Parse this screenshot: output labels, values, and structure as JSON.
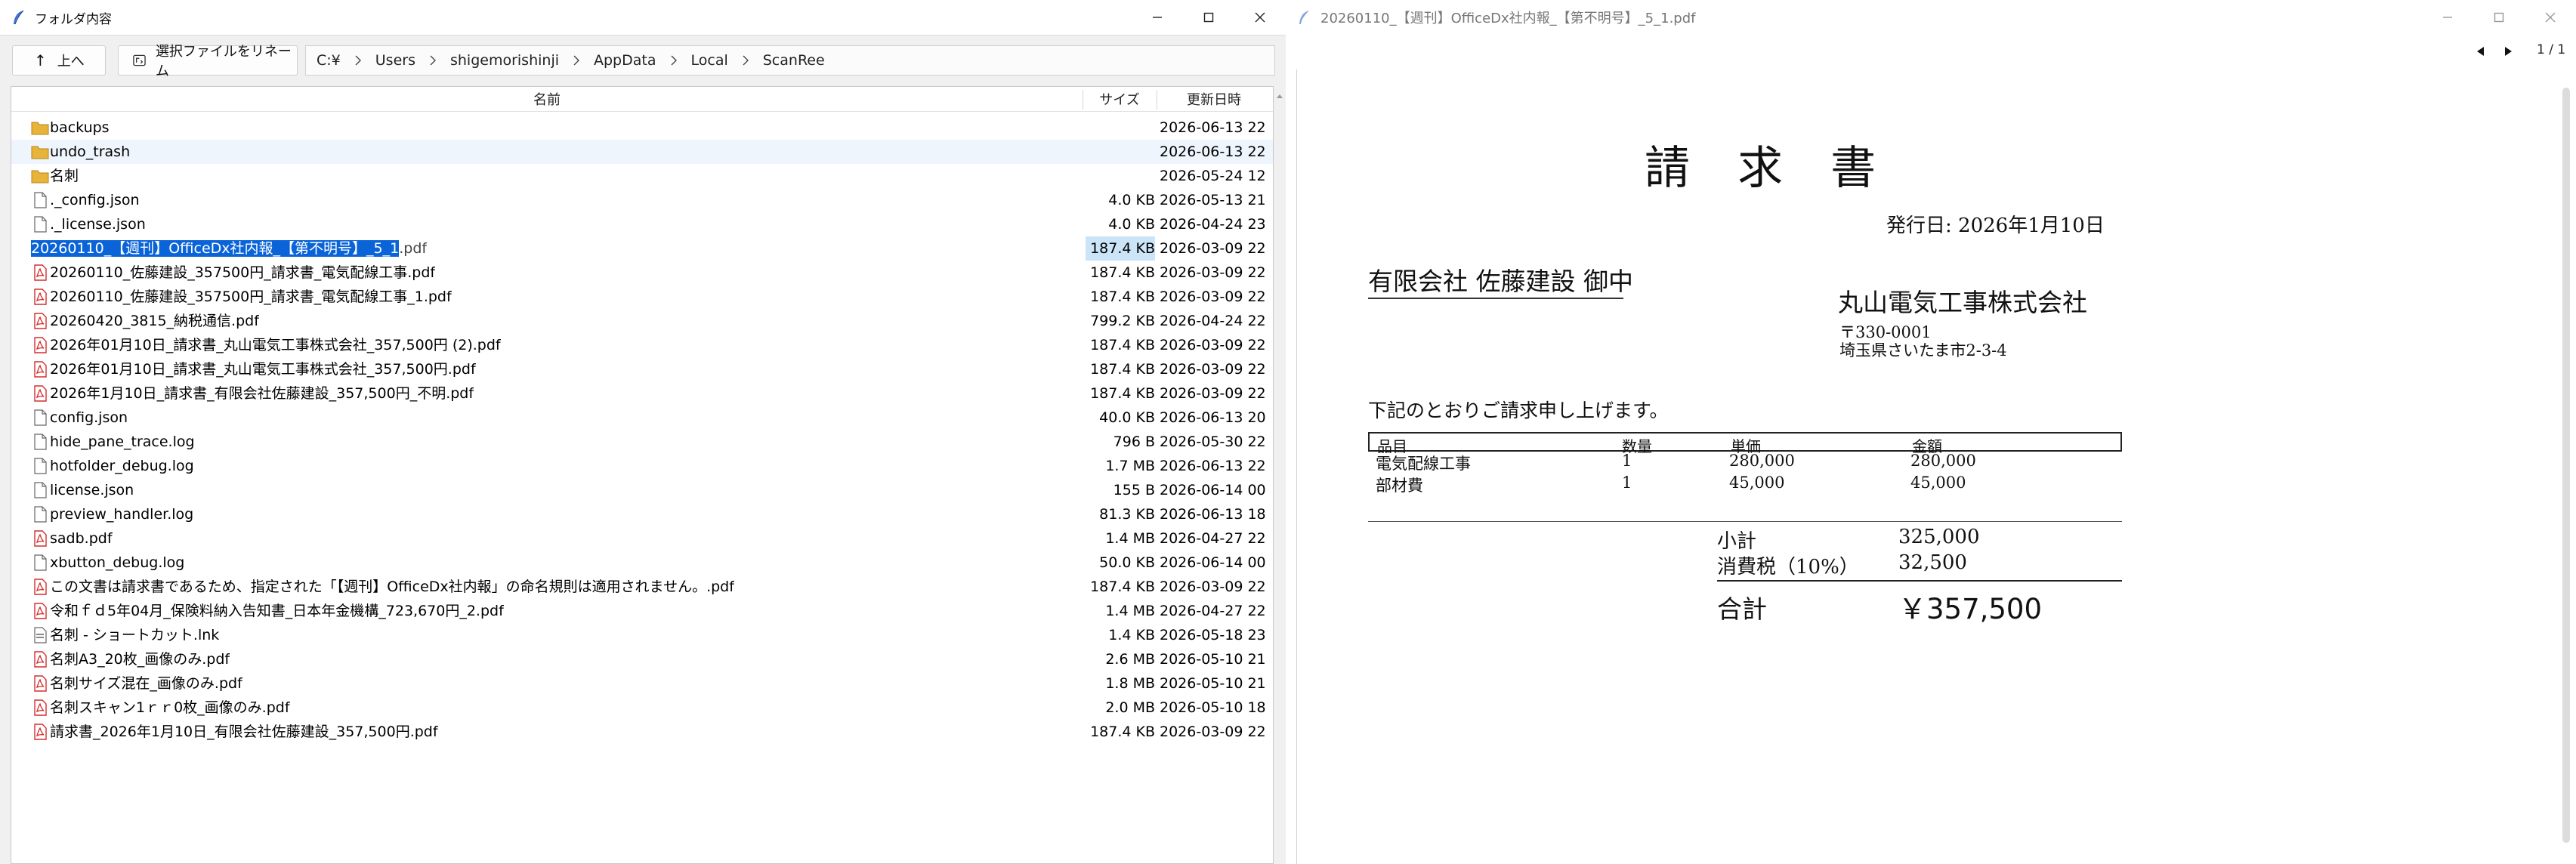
{
  "folder_window": {
    "title": "フォルダ内容",
    "toolbar": {
      "up_label": "上へ",
      "rename_label": "選択ファイルをリネーム"
    },
    "breadcrumb": [
      "C:¥",
      "Users",
      "shigemorishinji",
      "AppData",
      "Local",
      "ScanRee"
    ],
    "columns": {
      "name": "名前",
      "size": "サイズ",
      "modified": "更新日時"
    },
    "rows": [
      {
        "type": "folder",
        "name": "backups",
        "size": "",
        "date": "2026-06-13 22"
      },
      {
        "type": "folder",
        "name": "undo_trash",
        "size": "",
        "date": "2026-06-13 22"
      },
      {
        "type": "folder",
        "name": "名刺",
        "size": "",
        "date": "2026-05-24 12"
      },
      {
        "type": "file",
        "name": "._config.json",
        "size": "4.0 KB",
        "date": "2026-05-13 21"
      },
      {
        "type": "file",
        "name": "._license.json",
        "size": "4.0 KB",
        "date": "2026-04-24 23"
      },
      {
        "type": "pdf",
        "name": "20260110_【週刊】OfficeDx社内報_【第不明号】_5_1",
        "ext": ".pdf",
        "size": "187.4 KB",
        "date": "2026-03-09 22",
        "selected": true
      },
      {
        "type": "pdf",
        "name": "20260110_佐藤建設_357500円_請求書_電気配線工事.pdf",
        "size": "187.4 KB",
        "date": "2026-03-09 22"
      },
      {
        "type": "pdf",
        "name": "20260110_佐藤建設_357500円_請求書_電気配線工事_1.pdf",
        "size": "187.4 KB",
        "date": "2026-03-09 22"
      },
      {
        "type": "pdf",
        "name": "20260420_3815_納税通信.pdf",
        "size": "799.2 KB",
        "date": "2026-04-24 22"
      },
      {
        "type": "pdf",
        "name": "2026年01月10日_請求書_丸山電気工事株式会社_357,500円 (2).pdf",
        "size": "187.4 KB",
        "date": "2026-03-09 22"
      },
      {
        "type": "pdf",
        "name": "2026年01月10日_請求書_丸山電気工事株式会社_357,500円.pdf",
        "size": "187.4 KB",
        "date": "2026-03-09 22"
      },
      {
        "type": "pdf",
        "name": "2026年1月10日_請求書_有限会社佐藤建設_357,500円_不明.pdf",
        "size": "187.4 KB",
        "date": "2026-03-09 22"
      },
      {
        "type": "file",
        "name": "config.json",
        "size": "40.0 KB",
        "date": "2026-06-13 20"
      },
      {
        "type": "file",
        "name": "hide_pane_trace.log",
        "size": "796 B",
        "date": "2026-05-30 22"
      },
      {
        "type": "file",
        "name": "hotfolder_debug.log",
        "size": "1.7 MB",
        "date": "2026-06-13 22"
      },
      {
        "type": "file",
        "name": "license.json",
        "size": "155 B",
        "date": "2026-06-14 00"
      },
      {
        "type": "file",
        "name": "preview_handler.log",
        "size": "81.3 KB",
        "date": "2026-06-13 18"
      },
      {
        "type": "pdf",
        "name": "sadb.pdf",
        "size": "1.4 MB",
        "date": "2026-04-27 22"
      },
      {
        "type": "file",
        "name": "xbutton_debug.log",
        "size": "50.0 KB",
        "date": "2026-06-14 00"
      },
      {
        "type": "pdf",
        "name": "この文書は請求書であるため、指定された「【週刊】OfficeDx社内報」の命名規則は適用されません。.pdf",
        "size": "187.4 KB",
        "date": "2026-03-09 22"
      },
      {
        "type": "pdf",
        "name": "令和ｆｄ5年04月_保険料納入告知書_日本年金機構_723,670円_2.pdf",
        "size": "1.4 MB",
        "date": "2026-04-27 22"
      },
      {
        "type": "lnk",
        "name": "名刺 - ショートカット.lnk",
        "size": "1.4 KB",
        "date": "2026-05-18 23"
      },
      {
        "type": "pdf",
        "name": "名刺A3_20枚_画像のみ.pdf",
        "size": "2.6 MB",
        "date": "2026-05-10 21"
      },
      {
        "type": "pdf",
        "name": "名刺サイズ混在_画像のみ.pdf",
        "size": "1.8 MB",
        "date": "2026-05-10 21"
      },
      {
        "type": "pdf",
        "name": "名刺スキャン1ｒｒ0枚_画像のみ.pdf",
        "size": "2.0 MB",
        "date": "2026-05-10 18"
      },
      {
        "type": "pdf",
        "name": "請求書_2026年1月10日_有限会社佐藤建設_357,500円.pdf",
        "size": "187.4 KB",
        "date": "2026-03-09 22"
      }
    ]
  },
  "pdf_window": {
    "title": "20260110_【週刊】OfficeDx社内報_【第不明号】_5_1.pdf",
    "page_indicator": "1 / 1",
    "invoice": {
      "title": "請 求 書",
      "issue_date": "発行日: 2026年1月10日",
      "bill_to": "有限会社 佐藤建設 御中",
      "company": "丸山電気工事株式会社",
      "zip": "〒330-0001",
      "address": "埼玉県さいたま市2-3-4",
      "intro": "下記のとおりご請求申し上げます。",
      "headers": [
        "品目",
        "数量",
        "単価",
        "金額"
      ],
      "items": [
        {
          "item": "電気配線工事",
          "qty": "1",
          "unit": "280,000",
          "amount": "280,000"
        },
        {
          "item": "部材費",
          "qty": "1",
          "unit": "45,000",
          "amount": "45,000"
        }
      ],
      "subtotal_label": "小計",
      "subtotal": "325,000",
      "tax_label": "消費税（10%）",
      "tax": "32,500",
      "total_label": "合計",
      "total": "￥357,500"
    }
  },
  "icons": {
    "folder_color": "#e8b339",
    "pdf_color": "#d32f2f"
  }
}
